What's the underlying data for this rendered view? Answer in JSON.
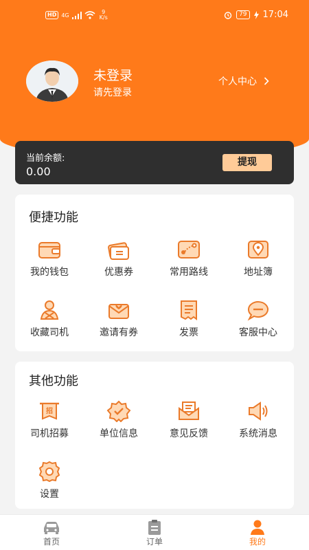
{
  "status_bar": {
    "hd": "HD",
    "signal": "4G",
    "speed_value": "9",
    "speed_unit": "K/s",
    "battery": "79",
    "time": "17:04"
  },
  "user": {
    "name": "未登录",
    "subtitle": "请先登录",
    "center_link": "个人中心"
  },
  "balance": {
    "label": "当前余额:",
    "value": "0.00",
    "withdraw_label": "提现"
  },
  "quick_functions": {
    "title": "便捷功能",
    "items": [
      {
        "label": "我的钱包",
        "icon": "wallet-icon"
      },
      {
        "label": "优惠券",
        "icon": "coupon-icon"
      },
      {
        "label": "常用路线",
        "icon": "route-icon"
      },
      {
        "label": "地址簿",
        "icon": "address-book-icon"
      },
      {
        "label": "收藏司机",
        "icon": "favorite-driver-icon"
      },
      {
        "label": "邀请有券",
        "icon": "invite-envelope-icon"
      },
      {
        "label": "发票",
        "icon": "invoice-icon"
      },
      {
        "label": "客服中心",
        "icon": "customer-service-icon"
      }
    ]
  },
  "other_functions": {
    "title": "其他功能",
    "items": [
      {
        "label": "司机招募",
        "icon": "recruit-banner-icon",
        "glyph": "招"
      },
      {
        "label": "单位信息",
        "icon": "company-badge-icon"
      },
      {
        "label": "意见反馈",
        "icon": "feedback-mail-icon"
      },
      {
        "label": "系统消息",
        "icon": "speaker-icon"
      },
      {
        "label": "设置",
        "icon": "settings-gear-icon"
      }
    ]
  },
  "tabs": [
    {
      "label": "首页",
      "icon": "car-icon",
      "active": false
    },
    {
      "label": "订单",
      "icon": "clipboard-icon",
      "active": false
    },
    {
      "label": "我的",
      "icon": "person-icon",
      "active": true
    }
  ],
  "colors": {
    "accent": "#ff7a1a",
    "card_dark": "#2f2f2f",
    "button_light": "#ffcb98"
  }
}
